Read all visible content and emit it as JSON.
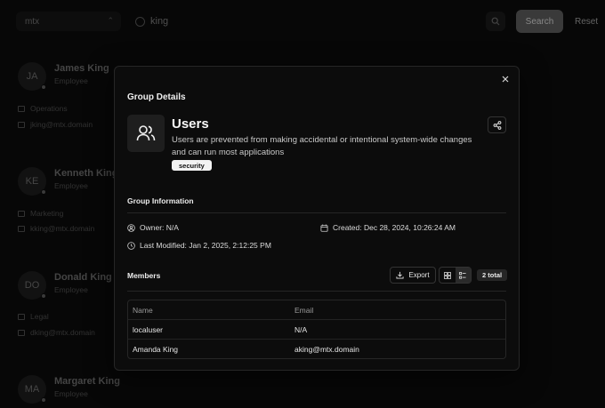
{
  "background": {
    "domain_select": "mtx",
    "search_value": "king",
    "search_button": "Search",
    "reset_button": "Reset",
    "people": [
      {
        "initials": "JA",
        "name": "James King",
        "role": "Employee",
        "department": "Operations",
        "email": "jking@mtx.domain"
      },
      {
        "initials": "KE",
        "name": "Kenneth King",
        "role": "Employee",
        "department": "Marketing",
        "email": "kking@mtx.domain"
      },
      {
        "initials": "DO",
        "name": "Donald King",
        "role": "Employee",
        "department": "Legal",
        "email": "dking@mtx.domain"
      },
      {
        "initials": "MA",
        "name": "Margaret King",
        "role": "Employee"
      }
    ]
  },
  "modal": {
    "title": "Group Details",
    "group": {
      "name": "Users",
      "description": "Users are prevented from making accidental or intentional system-wide changes and can run most applications",
      "tag": "security"
    },
    "info_section": {
      "title": "Group Information",
      "owner": "Owner: N/A",
      "created": "Created: Dec 28, 2024, 10:26:24 AM",
      "last_modified": "Last Modified: Jan 2, 2025, 2:12:25 PM"
    },
    "members_section": {
      "title": "Members",
      "export_label": "Export",
      "total_badge": "2 total",
      "columns": [
        "Name",
        "Email"
      ],
      "rows": [
        {
          "name": "localuser",
          "email": "N/A"
        },
        {
          "name": "Amanda King",
          "email": "aking@mtx.domain"
        }
      ]
    }
  },
  "icons": [
    "search-icon",
    "close-icon",
    "users-icon",
    "share-icon",
    "user-icon",
    "calendar-icon",
    "clock-icon",
    "download-icon",
    "grid-view-icon",
    "list-view-icon",
    "building-icon",
    "mail-icon"
  ]
}
